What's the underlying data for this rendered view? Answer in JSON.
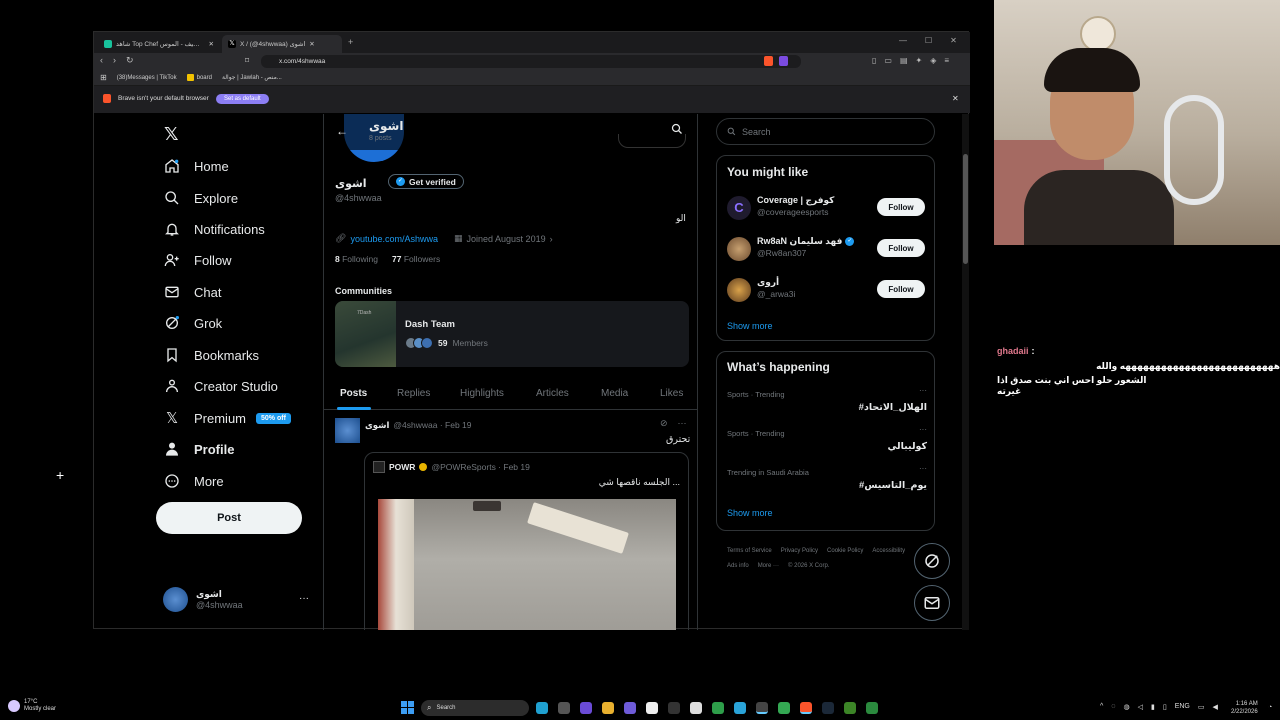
{
  "browser": {
    "tabs": [
      {
        "label": "شاهد Top Chef من أي شيف - الموس..."
      },
      {
        "label": "X / (@4shwwaa) اشوى"
      }
    ],
    "url": "x.com/4shwwaa",
    "bookmarks": [
      "(38)Messages | TikTok",
      "board",
      "جوالة | Jawlah - منص..."
    ],
    "default_notice": "Brave isn't your default browser",
    "set_default_label": "Set as default"
  },
  "sidebar": {
    "items": [
      {
        "label": "Home",
        "icon": "home-icon"
      },
      {
        "label": "Explore",
        "icon": "search-icon"
      },
      {
        "label": "Notifications",
        "icon": "bell-icon"
      },
      {
        "label": "Follow",
        "icon": "follow-icon"
      },
      {
        "label": "Chat",
        "icon": "mail-icon"
      },
      {
        "label": "Grok",
        "icon": "grok-icon"
      },
      {
        "label": "Bookmarks",
        "icon": "bookmark-icon"
      },
      {
        "label": "Creator Studio",
        "icon": "creator-icon"
      },
      {
        "label": "Premium",
        "icon": "x-icon"
      },
      {
        "label": "Profile",
        "icon": "person-icon"
      },
      {
        "label": "More",
        "icon": "more-icon"
      }
    ],
    "premium_badge": "50% off",
    "post_label": "Post",
    "account": {
      "name": "اشوى",
      "handle": "@4shwwaa"
    }
  },
  "profile": {
    "header_name": "اشوى",
    "header_posts": "8 posts",
    "name": "اشوى",
    "verify_label": "Get verified",
    "handle": "@4shwwaa",
    "bio": "الو",
    "link": "youtube.com/Ashwwa",
    "joined": "Joined August 2019",
    "following_count": "8",
    "following_label": "Following",
    "followers_count": "77",
    "followers_label": "Followers",
    "communities_title": "Communities",
    "community": {
      "name": "Dash Team",
      "members_count": "59",
      "members_label": "Members",
      "thumb_text": "7Dash"
    },
    "tabs": [
      "Posts",
      "Replies",
      "Highlights",
      "Articles",
      "Media",
      "Likes"
    ]
  },
  "post": {
    "author": "اشوى",
    "handle_date": "@4shwwaa · Feb 19",
    "text": "تحترق",
    "quote": {
      "author": "POWR",
      "handle_date": "@POWReSports · Feb 19",
      "text": "الجلسه ناقصها شي ..."
    }
  },
  "right": {
    "search_placeholder": "Search",
    "you_might_like": "You might like",
    "suggestions": [
      {
        "name": "Coverage | كوفرج",
        "handle": "@coverageesports",
        "follow": "Follow"
      },
      {
        "name": "Rw8aN فهد سليمان",
        "handle": "@Rw8an307",
        "follow": "Follow"
      },
      {
        "name": "أروى",
        "handle": "@_arwa3i",
        "follow": "Follow"
      }
    ],
    "show_more": "Show more",
    "whats_happening": "What’s happening",
    "trends": [
      {
        "context": "Sports · Trending",
        "name": "#الهلال_الاتحاد"
      },
      {
        "context": "Sports · Trending",
        "name": "كوليبالي"
      },
      {
        "context": "Trending in Saudi Arabia",
        "name": "#يوم_التاسيس"
      }
    ],
    "footer": [
      "Terms of Service",
      "Privacy Policy",
      "Cookie Policy",
      "Accessibility",
      "Ads info",
      "More ···",
      "© 2026 X Corp."
    ]
  },
  "chat": {
    "user": "ghadaii",
    "line1": "ههههههههههههههههههههههههههه والله",
    "line2": "الشعور حلو احس اني بنت صدق اذا غيرته",
    "user_color": "#e0788c"
  },
  "taskbar": {
    "weather_temp": "17°C",
    "weather_desc": "Mostly clear",
    "search_label": "Search",
    "lang": "ENG",
    "time": "1:16 AM",
    "date": "2/22/2026"
  },
  "colors": {
    "accent": "#1d9bf0",
    "premium": "#1d9bf0"
  }
}
